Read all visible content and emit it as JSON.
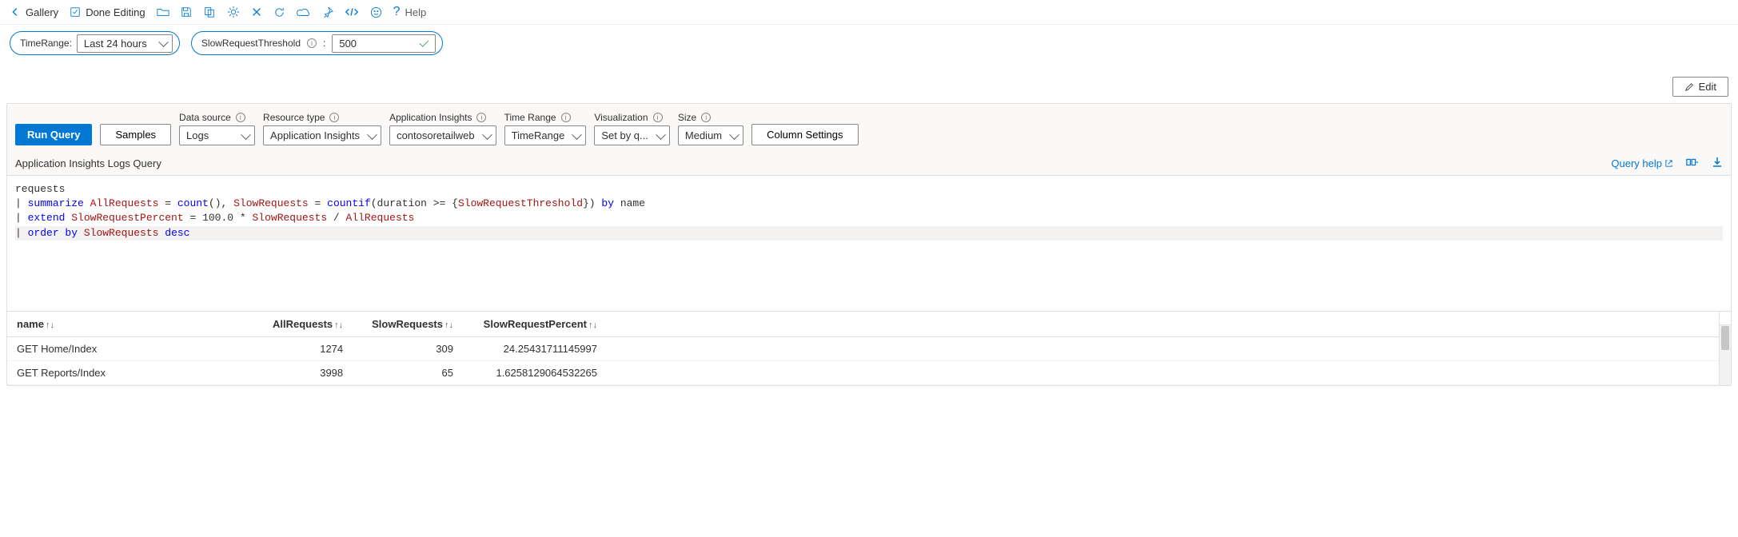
{
  "toolbar": {
    "gallery": "Gallery",
    "done_editing": "Done Editing",
    "help": "Help"
  },
  "params": {
    "time_range_label": "TimeRange:",
    "time_range_value": "Last 24 hours",
    "threshold_label": "SlowRequestThreshold",
    "threshold_value": "500"
  },
  "edit_button": "Edit",
  "query_controls": {
    "run_query": "Run Query",
    "samples": "Samples",
    "data_source_label": "Data source",
    "data_source_value": "Logs",
    "resource_type_label": "Resource type",
    "resource_type_value": "Application Insights",
    "app_insights_label": "Application Insights",
    "app_insights_value": "contosoretailweb",
    "time_range_label": "Time Range",
    "time_range_value": "TimeRange",
    "visualization_label": "Visualization",
    "visualization_value": "Set by q...",
    "size_label": "Size",
    "size_value": "Medium",
    "column_settings": "Column Settings"
  },
  "query_title": "Application Insights Logs Query",
  "query_help": "Query help",
  "query_text": {
    "l1": "requests",
    "l2_kw1": "summarize",
    "l2_id1": "AllRequests",
    "l2_eq": " = ",
    "l2_fn1": "count",
    "l2_sep1": "(), ",
    "l2_id2": "SlowRequests",
    "l2_fn2": "countif",
    "l2_p1": "(duration >= {",
    "l2_p2": "SlowRequestThreshold",
    "l2_p3": "}) ",
    "l2_kw2": "by",
    "l2_tail": " name",
    "l3_kw1": "extend",
    "l3_id1": "SlowRequestPercent",
    "l3_mid": " = 100.0 * ",
    "l3_id2": "SlowRequests",
    "l3_mid2": " / ",
    "l3_id3": "AllRequests",
    "l4_kw1": "order by",
    "l4_id1": "SlowRequests",
    "l4_kw2": "desc"
  },
  "results": {
    "columns": [
      "name",
      "AllRequests",
      "SlowRequests",
      "SlowRequestPercent"
    ],
    "rows": [
      {
        "name": "GET Home/Index",
        "AllRequests": "1274",
        "SlowRequests": "309",
        "SlowRequestPercent": "24.25431711145997"
      },
      {
        "name": "GET Reports/Index",
        "AllRequests": "3998",
        "SlowRequests": "65",
        "SlowRequestPercent": "1.6258129064532265"
      }
    ]
  }
}
